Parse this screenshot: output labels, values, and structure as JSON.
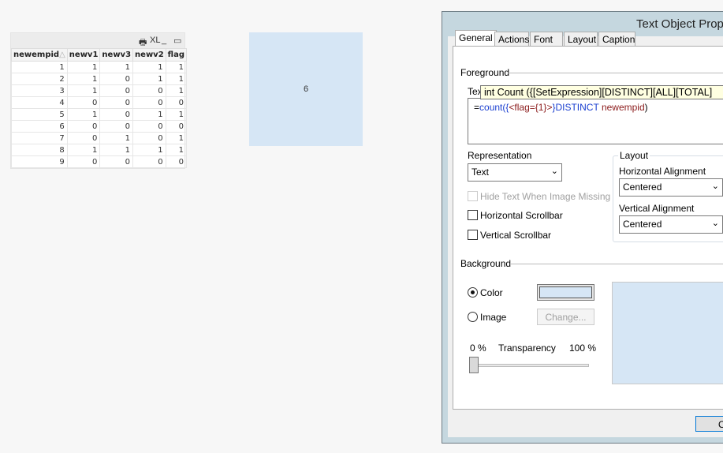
{
  "table": {
    "toolbar": [
      "🖶",
      "XL",
      "_",
      "▭"
    ],
    "columns": [
      "newempid",
      "newv1",
      "newv3",
      "newv2",
      "flag"
    ],
    "sort_indicator": "△",
    "rows": [
      [
        "1",
        "1",
        "1",
        "1",
        "1"
      ],
      [
        "2",
        "1",
        "0",
        "1",
        "1"
      ],
      [
        "3",
        "1",
        "0",
        "0",
        "1"
      ],
      [
        "4",
        "0",
        "0",
        "0",
        "0"
      ],
      [
        "5",
        "1",
        "0",
        "1",
        "1"
      ],
      [
        "6",
        "0",
        "0",
        "0",
        "0"
      ],
      [
        "7",
        "0",
        "1",
        "0",
        "1"
      ],
      [
        "8",
        "1",
        "1",
        "1",
        "1"
      ],
      [
        "9",
        "0",
        "0",
        "0",
        "0"
      ]
    ]
  },
  "text_object": {
    "value": "6",
    "color": "#d6e6f5"
  },
  "dialog": {
    "title": "Text Object Prop",
    "tabs": [
      "General",
      "Actions",
      "Font",
      "Layout",
      "Caption"
    ],
    "foreground_label": "Foreground",
    "text_label": "Tex",
    "tooltip": "int Count ({[SetExpression][DISTINCT][ALL][TOTAL]",
    "expression": {
      "eq": "=",
      "func": "count",
      "p1": "({",
      "set": "<flag={1}>",
      "p2": "}",
      "kw": "DISTINCT",
      "field": "newempid",
      "p3": ")"
    },
    "representation_label": "Representation",
    "representation_value": "Text",
    "hide_text_label": "Hide Text When Image Missing",
    "hscroll_label": "Horizontal Scrollbar",
    "vscroll_label": "Vertical Scrollbar",
    "layout_label": "Layout",
    "halign_label": "Horizontal Alignment",
    "halign_value": "Centered",
    "valign_label": "Vertical Alignment",
    "valign_value": "Centered",
    "background_label": "Background",
    "color_label": "Color",
    "image_label": "Image",
    "change_button": "Change...",
    "transparency_label": "Transparency",
    "transparency_min": "0 %",
    "transparency_max": "100 %",
    "transparency_value": 0,
    "background_color": "#d6e6f5",
    "ok_button": "O"
  }
}
